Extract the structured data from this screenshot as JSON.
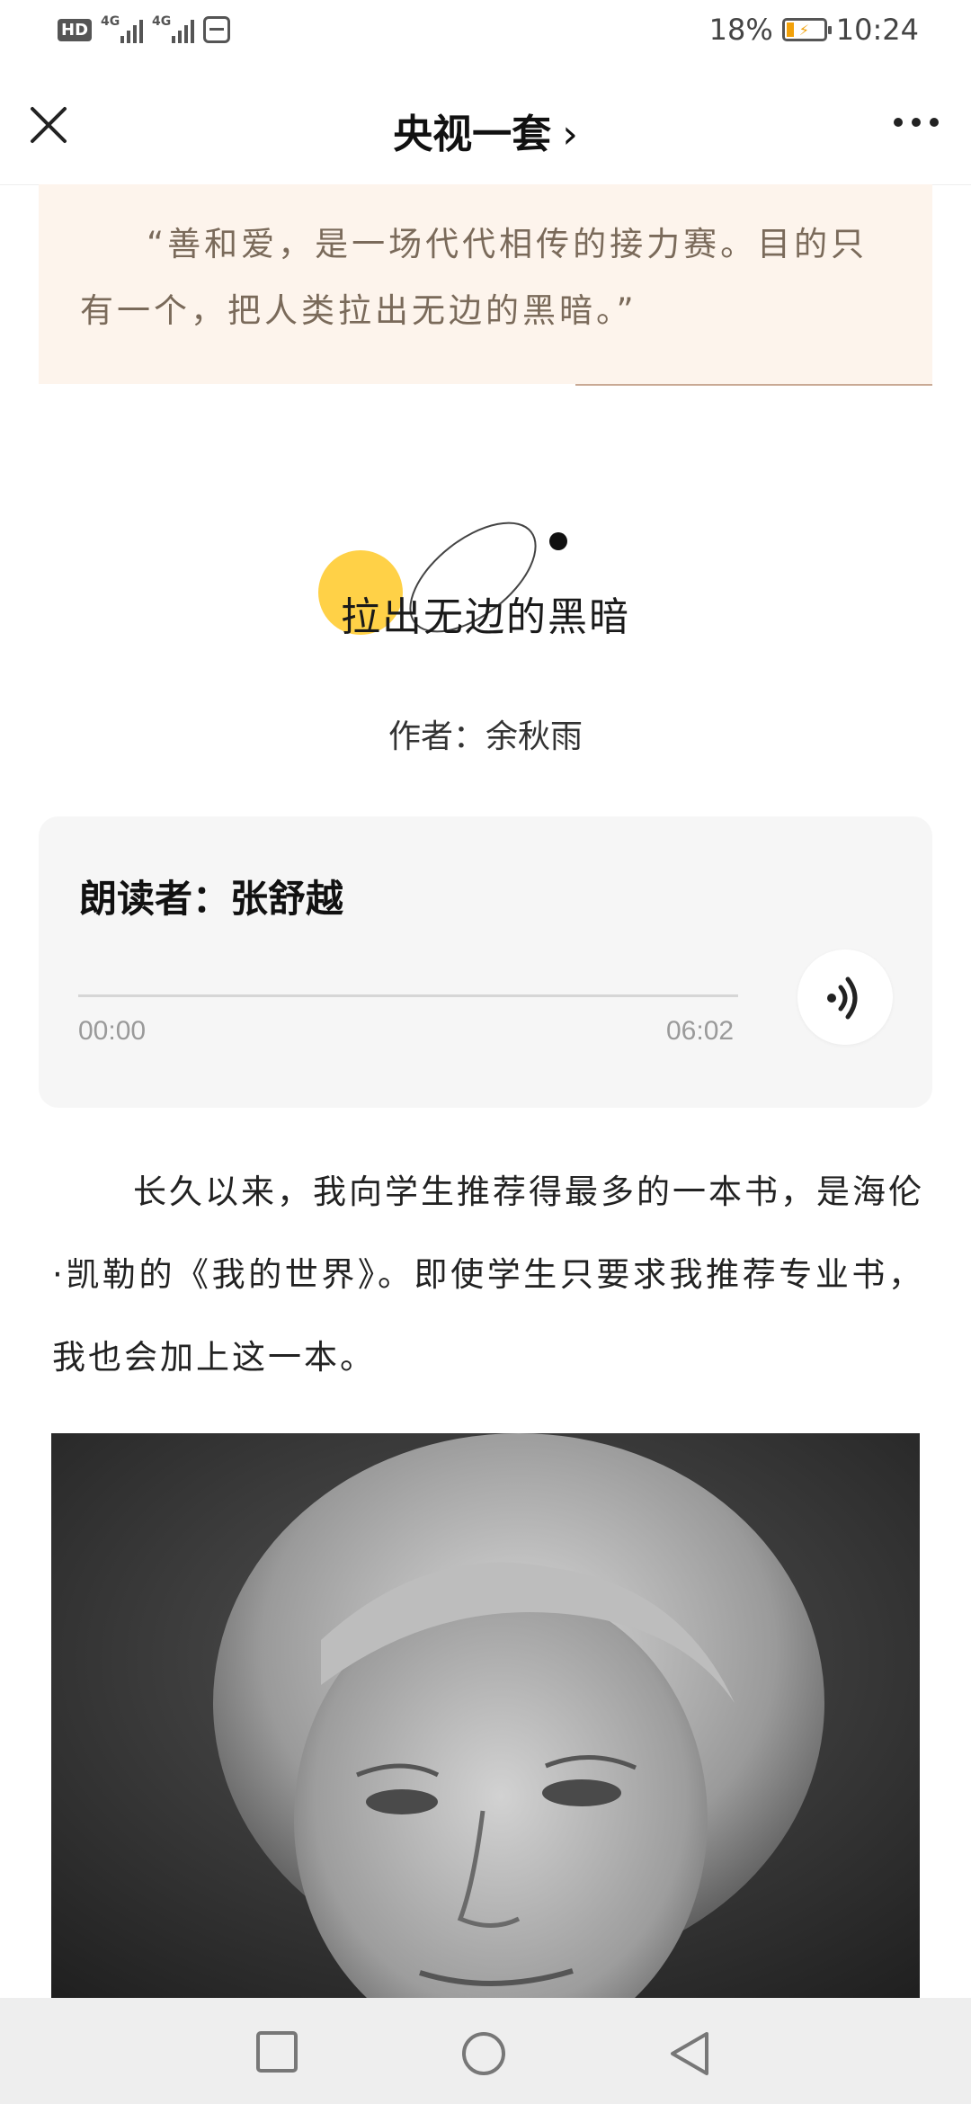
{
  "status_bar": {
    "network1": "4G",
    "network2": "4G",
    "battery": "18%",
    "time": "10:24"
  },
  "header": {
    "title": "央视一套",
    "chevron": "›"
  },
  "quote": {
    "text": "“善和爱，是一场代代相传的接力赛。目的只有一个，把人类拉出无边的黑暗。”"
  },
  "article": {
    "art_title": "拉出无边的黑暗",
    "author": "作者：余秋雨"
  },
  "audio": {
    "reader": "朗读者：张舒越",
    "current_time": "00:00",
    "duration": "06:02",
    "progress": 0
  },
  "body": {
    "paragraph": "长久以来，我向学生推荐得最多的一本书，是海伦·凯勒的《我的世界》。即使学生只要求我推荐专业书，我也会加上这一本。"
  },
  "icons": {
    "close": "close-icon",
    "more": "more-dots-icon",
    "audio": "sound-wave-icon",
    "nav_recent": "square-icon",
    "nav_home": "circle-icon",
    "nav_back": "triangle-back-icon"
  },
  "colors": {
    "quote_bg": "#fdf4ec",
    "quote_text": "#7a6a5a",
    "sun": "#ffd147",
    "audio_card": "#f6f6f6"
  }
}
